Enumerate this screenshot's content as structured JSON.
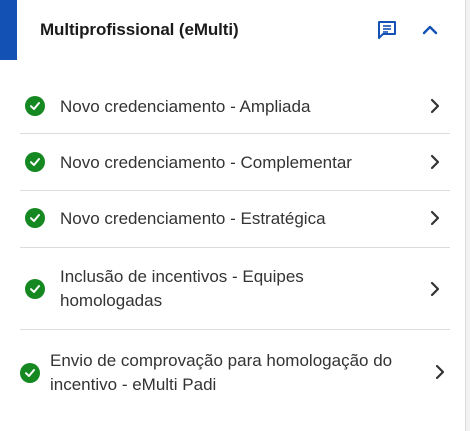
{
  "section": {
    "title": "Multiprofissional (eMulti)",
    "accent_color": "#1351b4",
    "comment_icon": "comment-icon",
    "collapse_icon": "chevron-up-icon"
  },
  "items": [
    {
      "label": "Novo credenciamento - Ampliada",
      "status": "completed",
      "status_color": "#168821"
    },
    {
      "label": "Novo credenciamento - Complementar",
      "status": "completed",
      "status_color": "#168821"
    },
    {
      "label": "Novo credenciamento - Estratégica",
      "status": "completed",
      "status_color": "#168821"
    },
    {
      "label": "Inclusão de incentivos - Equipes homologadas",
      "status": "completed",
      "status_color": "#168821"
    },
    {
      "label": "Envio de comprovação para homologação do incentivo - eMulti Padi",
      "status": "completed",
      "status_color": "#168821"
    }
  ]
}
